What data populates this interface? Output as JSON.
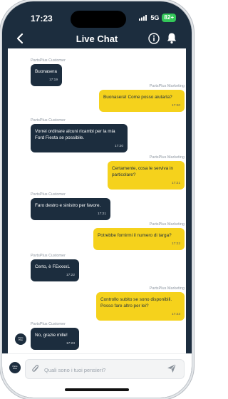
{
  "status_bar": {
    "time": "17:23",
    "network": "5G",
    "battery": "82+"
  },
  "header": {
    "title": "Live Chat"
  },
  "avatar_label": "Parts\nPlus",
  "messages": [
    {
      "direction": "in",
      "sender": "PartsPlus Customer",
      "text": "Buonasera",
      "time": "17:19"
    },
    {
      "direction": "out",
      "sender": "PartsPlus Marketing",
      "text": "Buonasera! Come posso aiutarla?",
      "time": "17:20"
    },
    {
      "direction": "in",
      "sender": "PartsPlus Customer",
      "text": "Vorrei ordinare alcuni ricambi per la mia\nFord Fiesta se possibile.",
      "time": "17:20"
    },
    {
      "direction": "out",
      "sender": "PartsPlus Marketing",
      "text": "Certamente, cosa le serviva in\nparticolare?",
      "time": "17:21"
    },
    {
      "direction": "in",
      "sender": "PartsPlus Customer",
      "text": "Faro destro e sinistro per favore.",
      "time": "17:21"
    },
    {
      "direction": "out",
      "sender": "PartsPlus Marketing",
      "text": "Potrebbe fornirmi il numero di targa?",
      "time": "17:22"
    },
    {
      "direction": "in",
      "sender": "PartsPlus Customer",
      "text": "Certo, è FExxxxL",
      "time": "17:22"
    },
    {
      "direction": "out",
      "sender": "PartsPlus Marketing",
      "text": "Controllo subito se sono disponibili.\nPosso fare altro per lei?",
      "time": "17:23"
    },
    {
      "direction": "in",
      "sender": "PartsPlus Customer",
      "text": "No, grazie mille!",
      "time": "17:23"
    }
  ],
  "composer": {
    "placeholder": "Quali sono i tuoi pensieri?"
  },
  "colors": {
    "navy": "#1c2d3e",
    "yellow": "#f5d21c",
    "battery": "#33c759"
  },
  "icons": [
    "back-arrow-icon",
    "info-icon",
    "bell-icon",
    "paperclip-icon",
    "send-icon"
  ]
}
